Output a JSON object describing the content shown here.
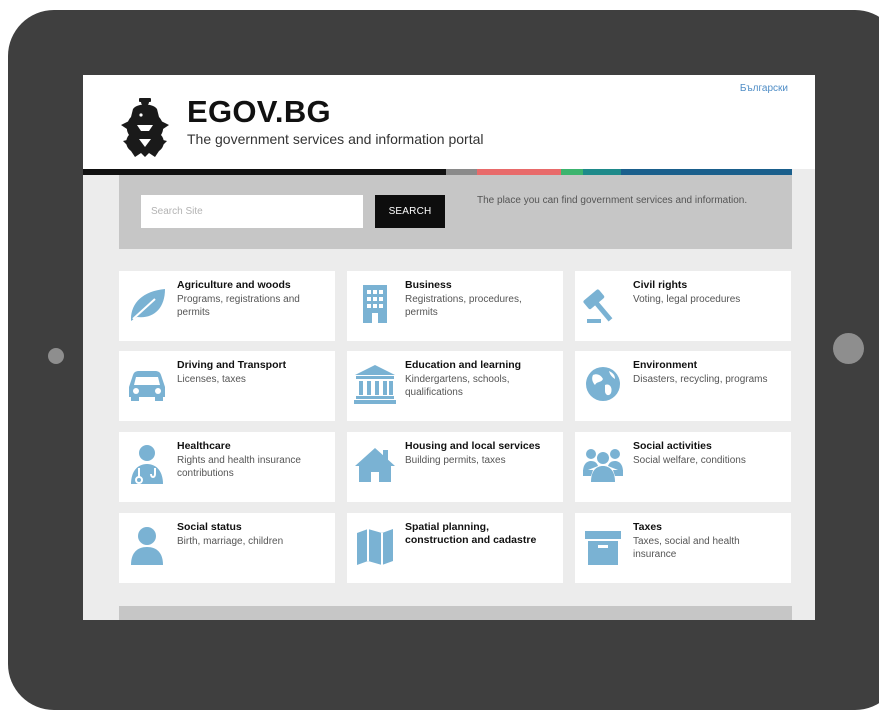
{
  "header": {
    "language_link": "Български",
    "title": "EGOV.BG",
    "subtitle": "The government services and information portal"
  },
  "color_bar": [
    "#111111",
    "#111111",
    "#111111",
    "#111111",
    "#8a8a8a",
    "#e86a6a",
    "#3cb46e",
    "#1e8a8a",
    "#1a5f8c"
  ],
  "search": {
    "placeholder": "Search Site",
    "value": "",
    "button_label": "SEARCH",
    "tagline": "The place you can find government services and information."
  },
  "accent_color": "#7ab2d3",
  "categories": [
    {
      "title": "Agriculture and woods",
      "description": "Programs, registrations and permits",
      "icon": "leaf-icon"
    },
    {
      "title": "Business",
      "description": "Registrations, procedures, permits",
      "icon": "office-building-icon"
    },
    {
      "title": "Civil rights",
      "description": "Voting, legal procedures",
      "icon": "gavel-icon"
    },
    {
      "title": "Driving and Transport",
      "description": "Licenses, taxes",
      "icon": "car-icon"
    },
    {
      "title": "Education and learning",
      "description": "Kindergartens, schools, qualifications",
      "icon": "institution-icon"
    },
    {
      "title": "Environment",
      "description": "Disasters, recycling, programs",
      "icon": "globe-icon"
    },
    {
      "title": "Healthcare",
      "description": "Rights and health insurance contributions",
      "icon": "doctor-icon"
    },
    {
      "title": "Housing and local services",
      "description": "Building permits, taxes",
      "icon": "house-icon"
    },
    {
      "title": "Social activities",
      "description": "Social welfare, conditions",
      "icon": "people-group-icon"
    },
    {
      "title": "Social status",
      "description": "Birth, marriage, children",
      "icon": "person-icon"
    },
    {
      "title": "Spatial planning, construction and cadastre",
      "description": "",
      "icon": "map-icon"
    },
    {
      "title": "Taxes",
      "description": "Taxes, social and health insurance",
      "icon": "archive-box-icon"
    }
  ]
}
